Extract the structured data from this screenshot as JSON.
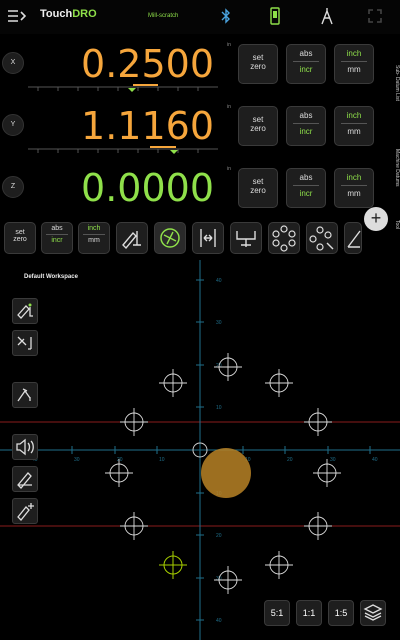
{
  "topbar": {
    "brand_main": "Touch",
    "brand_accent": "DRO",
    "mode_label": "Mill-scratch"
  },
  "axes": [
    {
      "name": "X",
      "value": "0.2500",
      "unit_tag": "in",
      "color": "#f6a63c",
      "set_zero": "set\nzero",
      "abs": "abs",
      "incr": "incr",
      "inch": "inch",
      "mm": "mm"
    },
    {
      "name": "Y",
      "value": "1.1160",
      "unit_tag": "in",
      "color": "#f6a63c",
      "set_zero": "set\nzero",
      "abs": "abs",
      "incr": "incr",
      "inch": "inch",
      "mm": "mm"
    },
    {
      "name": "Z",
      "value": "0.0000",
      "unit_tag": "in",
      "color": "#8fe04a",
      "set_zero": "set\nzero",
      "abs": "abs",
      "incr": "incr",
      "inch": "inch",
      "mm": "mm"
    }
  ],
  "side_tabs": {
    "sub_datum_list": "Sub- Datum List",
    "machine_datums": "Machine Datums",
    "tool": "Tool"
  },
  "toolbar": {
    "set_zero": "set\nzero",
    "abs": "abs",
    "incr": "incr",
    "inch": "inch",
    "mm": "mm"
  },
  "workspace": {
    "title": "Default Workspace"
  },
  "zoom": {
    "z1": "5:1",
    "z2": "1:1",
    "z3": "1:5"
  },
  "grid_labels": {
    "x_ticks": [
      "40",
      "30",
      "20",
      "10",
      "10",
      "20",
      "30",
      "40"
    ],
    "y_ticks": [
      "40",
      "30",
      "20",
      "10",
      "10",
      "20",
      "30",
      "40"
    ]
  },
  "colors": {
    "accent_orange": "#f6a63c",
    "accent_green": "#8fe04a",
    "axis_line": "#1f6f8b",
    "red_line": "#8a1d1d"
  }
}
